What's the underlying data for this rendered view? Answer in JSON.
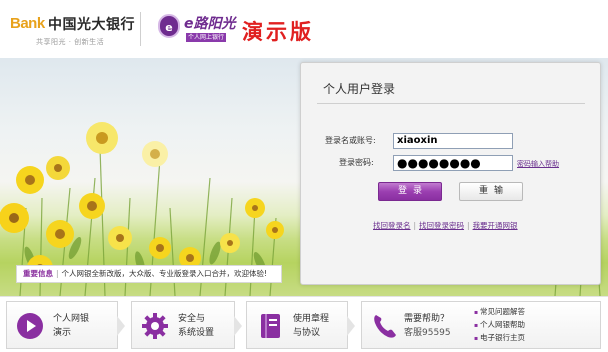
{
  "header": {
    "logo_prefix": "Bank",
    "bank_name": "中国光大银行",
    "slogan": "共享阳光 · 创新生活",
    "brand_icon": "e",
    "brand_name": "e路阳光",
    "brand_sub": "个人网上银行",
    "demo_title": "演示版"
  },
  "notice": {
    "label": "重要信息",
    "text": "个人网银全新改版，大众版、专业版登录入口合并，欢迎体验!"
  },
  "login": {
    "title": "个人用户登录",
    "account_label": "登录名或账号:",
    "account_value": "xiaoxin",
    "password_label": "登录密码:",
    "password_value": "●●●●●●●●",
    "keyboard_help": "密码输入帮助",
    "login_button": "登录",
    "reset_button": "重输",
    "links": [
      "找回登录名",
      "找回登录密码",
      "我要开通网银"
    ]
  },
  "tiles": [
    {
      "icon": "play-icon",
      "line1": "个人网银",
      "line2": "演示"
    },
    {
      "icon": "gear-icon",
      "line1": "安全与",
      "line2": "系统设置"
    },
    {
      "icon": "book-icon",
      "line1": "使用章程",
      "line2": "与协议"
    },
    {
      "icon": "phone-icon",
      "line1": "需要帮助？",
      "line2": "客服95595"
    }
  ],
  "help_links": [
    "常见问题解答",
    "个人网银帮助",
    "电子银行主页"
  ],
  "colors": {
    "brand_purple": "#8a2fa1",
    "demo_red": "#e02020",
    "bank_gold": "#e8a21c"
  }
}
